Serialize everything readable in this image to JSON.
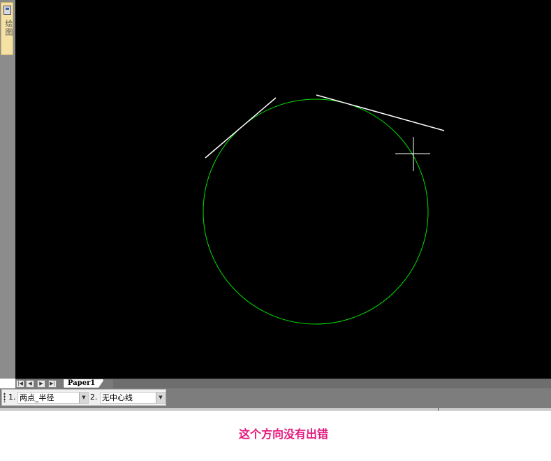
{
  "side_panel": {
    "tab_label": "绘图",
    "icon": "panel-icon"
  },
  "canvas": {
    "background": "#000000",
    "circle_color": "#00e000",
    "line_color": "#ffffff",
    "cursor_color": "#ffffff"
  },
  "tabs": {
    "nav_icons": [
      "first-icon",
      "prev-icon",
      "next-icon",
      "last-icon"
    ],
    "nav_glyphs": [
      "|◀",
      "◀",
      "▶",
      "▶|"
    ],
    "active": "Paper1"
  },
  "properties": {
    "item1": {
      "num": "1.",
      "value": "两点_半径"
    },
    "item2": {
      "num": "2.",
      "value": "无中心线"
    },
    "dropdown_glyph": "▼"
  },
  "caption": "这个方向没有出错",
  "colors": {
    "caption": "#e5197e",
    "chrome_gray": "#7d7d7d"
  }
}
